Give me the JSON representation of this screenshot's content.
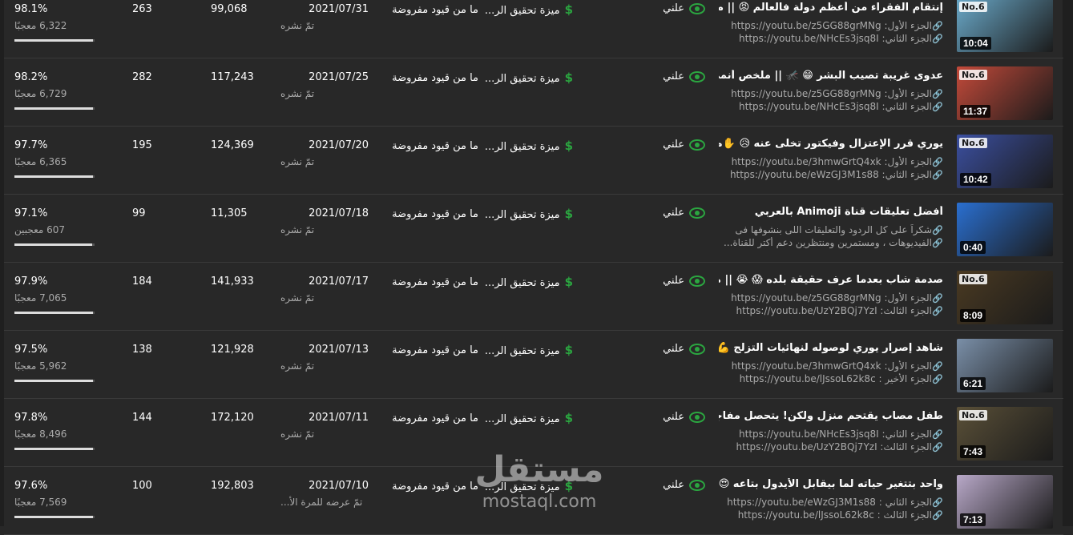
{
  "rows": [
    {
      "title": "إنتقام الفقراء من أعظم دولة فالعالم 😡 || ملخص...",
      "line1": "الجزء الأول: https://youtu.be/z5GG88grMNg",
      "line2": "الجزء الثاني: https://youtu.be/NHcEs3jsq8I",
      "duration": "10:04",
      "badge": "No.6",
      "visibility": "علني",
      "monetization": "ميزة تحقيق الر...",
      "restrictions": "ما من قيود مفروضة",
      "date": "2021/07/31",
      "date_sub": "تمّ نشره",
      "views": "99,068",
      "comments": "263",
      "like_pct": "98.1%",
      "like_count": "6,322 معجبًا",
      "like_fill": 0.981,
      "thumb_color": "#6aa9c9"
    },
    {
      "title": "عدوى غريبة تصيب البشر 😁 🦟 || ملخص أنمي ...",
      "line1": "الجزء الأول: https://youtu.be/z5GG88grMNg",
      "line2": "الجزء الثاني: https://youtu.be/NHcEs3jsq8I",
      "duration": "11:37",
      "badge": "No.6",
      "visibility": "علني",
      "monetization": "ميزة تحقيق الر...",
      "restrictions": "ما من قيود مفروضة",
      "date": "2021/07/25",
      "date_sub": "تمّ نشره",
      "views": "117,243",
      "comments": "282",
      "like_pct": "98.2%",
      "like_count": "6,729 معجبًا",
      "like_fill": 0.982,
      "thumb_color": "#c44a3a"
    },
    {
      "title": "يوري قرر الإعتزال وفيكتور تخلى عنه 😥 ✋ملخص...",
      "line1": "الجزء الأول: https://youtu.be/3hmwGrtQ4xk",
      "line2": "الجزء الثاني: https://youtu.be/eWzGJ3M1s88",
      "duration": "10:42",
      "badge": "No.6",
      "visibility": "علني",
      "monetization": "ميزة تحقيق الر...",
      "restrictions": "ما من قيود مفروضة",
      "date": "2021/07/20",
      "date_sub": "تمّ نشره",
      "views": "124,369",
      "comments": "195",
      "like_pct": "97.7%",
      "like_count": "6,365 معجبًا",
      "like_fill": 0.977,
      "thumb_color": "#3b4fa0"
    },
    {
      "title": "أفضل تعليقات قناة Animoji بالعربي",
      "line1": "شكراً على كل الردود والتعليقات اللى بنشوفها فى",
      "line2": "الفيديوهات ، ومستمرين ومنتظرين دعم أكتر للقناة...",
      "duration": "0:40",
      "badge": "",
      "visibility": "علني",
      "monetization": "ميزة تحقيق الر...",
      "restrictions": "ما من قيود مفروضة",
      "date": "2021/07/18",
      "date_sub": "تمّ نشره",
      "views": "11,305",
      "comments": "99",
      "like_pct": "97.1%",
      "like_count": "607 معجبين",
      "like_fill": 0.971,
      "thumb_color": "#2a6fd0"
    },
    {
      "title": "صدمة شاب بعدما عرف حقيقة بلده 😱 😭 || ملخص...",
      "line1": "الجزء الأول: https://youtu.be/z5GG88grMNg",
      "line2": "الجزء الثالث: https://youtu.be/UzY2BQj7YzI",
      "duration": "8:09",
      "badge": "No.6",
      "visibility": "علني",
      "monetization": "ميزة تحقيق الر...",
      "restrictions": "ما من قيود مفروضة",
      "date": "2021/07/17",
      "date_sub": "تمّ نشره",
      "views": "141,933",
      "comments": "184",
      "like_pct": "97.9%",
      "like_count": "7,065 معجبًا",
      "like_fill": 0.979,
      "thumb_color": "#4a3a22"
    },
    {
      "title": "شاهد إصرار يوري لوصوله لنهائيات التزلج 💪 || مل...",
      "line1": "الجزء الأول: https://youtu.be/3hmwGrtQ4xk",
      "line2": "الجزء الأخير : https://youtu.be/lJssoL62k8c",
      "duration": "6:21",
      "badge": "",
      "visibility": "علني",
      "monetization": "ميزة تحقيق الر...",
      "restrictions": "ما من قيود مفروضة",
      "date": "2021/07/13",
      "date_sub": "تمّ نشره",
      "views": "121,928",
      "comments": "138",
      "like_pct": "97.5%",
      "like_count": "5,962 معجبًا",
      "like_fill": 0.975,
      "thumb_color": "#7a8fa8"
    },
    {
      "title": "طفل مصاب يقتحم منزل ولكن! يتحصل مفاجأة ...",
      "line1": "الجزء الثاني: https://youtu.be/NHcEs3jsq8I",
      "line2": "الجزء الثالث: https://youtu.be/UzY2BQj7YzI",
      "duration": "7:43",
      "badge": "No.6",
      "visibility": "علني",
      "monetization": "ميزة تحقيق الر...",
      "restrictions": "ما من قيود مفروضة",
      "date": "2021/07/11",
      "date_sub": "تمّ نشره",
      "views": "172,120",
      "comments": "144",
      "like_pct": "97.8%",
      "like_count": "8,496 معجبًا",
      "like_fill": 0.978,
      "thumb_color": "#5a5038"
    },
    {
      "title": "واحد بتتغير حياته لما بيقابل الأيدول بتاعه 😍 || مل...",
      "line1": "الجزء الثاني : https://youtu.be/eWzGJ3M1s88",
      "line2": "الجزء الثالث : https://youtu.be/lJssoL62k8c",
      "duration": "7:13",
      "badge": "",
      "visibility": "علني",
      "monetization": "ميزة تحقيق الر...",
      "restrictions": "ما من قيود مفروضة",
      "date": "2021/07/10",
      "date_sub": "تمّ عرضه للمرة الأ...",
      "views": "192,803",
      "comments": "100",
      "like_pct": "97.6%",
      "like_count": "7,569 معجبًا",
      "like_fill": 0.976,
      "thumb_color": "#b8a8c8"
    }
  ],
  "watermark": {
    "arabic": "مستقل",
    "latin": "mostaql.com"
  },
  "colors": {
    "accent_green": "#2ba640",
    "background": "#282828"
  },
  "icons": {
    "visibility": "eye-icon",
    "monetization": "dollar-icon",
    "link": "link-icon"
  }
}
